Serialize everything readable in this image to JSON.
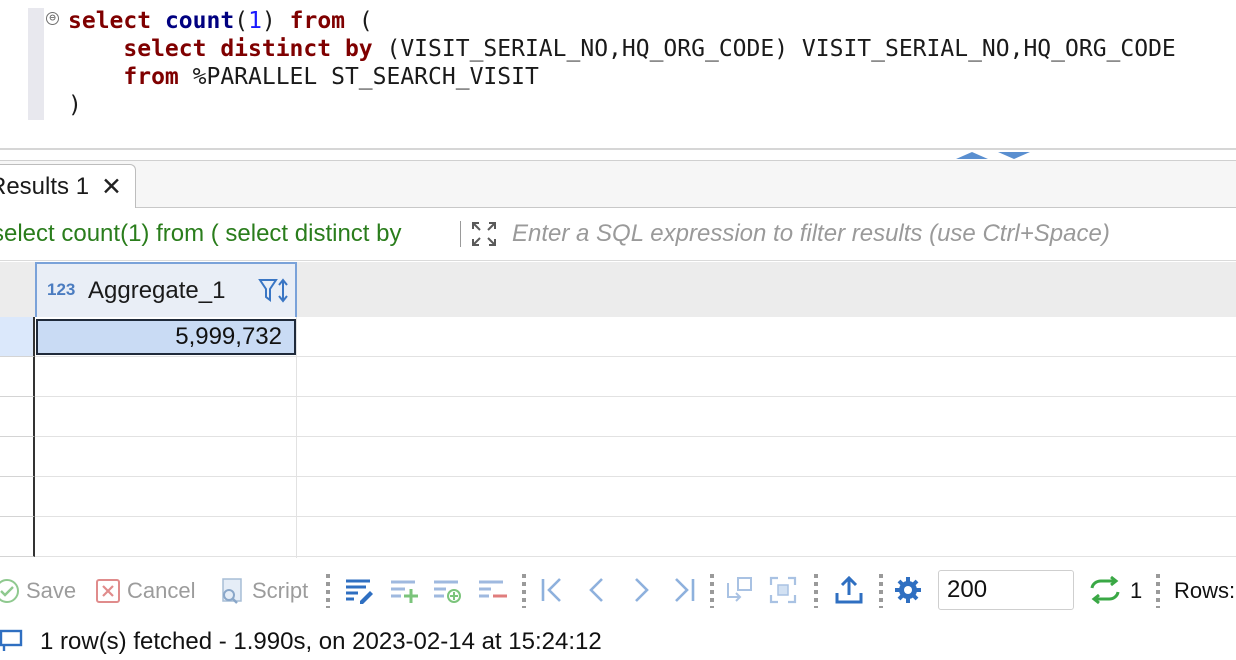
{
  "editor": {
    "fold_glyph": "⊖",
    "lines": [
      [
        {
          "t": "select",
          "c": "kw"
        },
        {
          "t": " ",
          "c": "id"
        },
        {
          "t": "count",
          "c": "fn"
        },
        {
          "t": "(",
          "c": "id"
        },
        {
          "t": "1",
          "c": "num"
        },
        {
          "t": ") ",
          "c": "id"
        },
        {
          "t": "from",
          "c": "kw"
        },
        {
          "t": " (",
          "c": "id"
        }
      ],
      [
        {
          "t": "    ",
          "c": "id"
        },
        {
          "t": "select distinct by",
          "c": "kw"
        },
        {
          "t": " (VISIT_SERIAL_NO,HQ_ORG_CODE) VISIT_SERIAL_NO,HQ_ORG_CODE",
          "c": "id"
        }
      ],
      [
        {
          "t": "    ",
          "c": "id"
        },
        {
          "t": "from",
          "c": "kw"
        },
        {
          "t": " %PARALLEL ST_SEARCH_VISIT",
          "c": "id"
        }
      ],
      [
        {
          "t": ")",
          "c": "id"
        }
      ]
    ]
  },
  "results_tab": {
    "label": "Results 1",
    "close_glyph": "✕"
  },
  "filter_bar": {
    "query_text": "select count(1) from ( select distinct by",
    "filter_placeholder": "Enter a SQL expression to filter results (use Ctrl+Space)"
  },
  "grid": {
    "column": {
      "type_badge": "123",
      "name": "Aggregate_1"
    },
    "rows": [
      {
        "value": "5,999,732"
      }
    ],
    "empty_rows": 5
  },
  "toolbar": {
    "save_label": "Save",
    "cancel_label": "Cancel",
    "script_label": "Script",
    "fetch_size": "200",
    "refresh_count": "1",
    "rows_label": "Rows:"
  },
  "status": {
    "text": "1 row(s) fetched - 1.990s, on 2023-02-14 at 15:24:12"
  },
  "colors": {
    "keyword": "#7f0000",
    "function": "#000080",
    "number": "#1a1aff",
    "query_green": "#2a7d1c",
    "selection": "#c9dbf4",
    "accent_blue": "#2f6fc1"
  }
}
